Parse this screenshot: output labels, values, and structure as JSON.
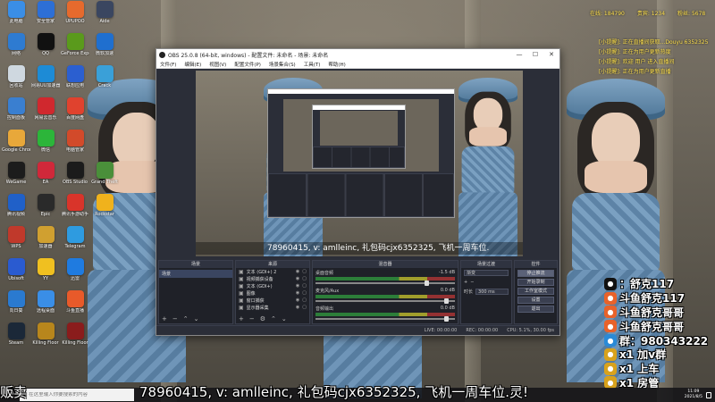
{
  "colors": {
    "overlay_yellow": "#ffe14d",
    "obs_bg": "#2b2e38",
    "taskbar": "#141418"
  },
  "desktop_icons": [
    {
      "label": "此电脑",
      "icon": "computer-icon",
      "color": "#3a8ee6"
    },
    {
      "label": "安全管家",
      "icon": "shield-icon",
      "color": "#2d6fd6"
    },
    {
      "label": "UPUPOO",
      "icon": "app-icon",
      "color": "#e66a2d"
    },
    {
      "label": "Aide",
      "icon": "app-icon",
      "color": "#3a4660"
    },
    {
      "label": "网络",
      "icon": "network-icon",
      "color": "#2e7bd1"
    },
    {
      "label": "QQ",
      "icon": "qq-icon",
      "color": "#111"
    },
    {
      "label": "GeForce Experience",
      "icon": "nvidia-icon",
      "color": "#5a9a1c"
    },
    {
      "label": "微软加速",
      "icon": "app-icon",
      "color": "#1f6fcf"
    },
    {
      "label": "回收站",
      "icon": "recycle-bin-icon",
      "color": "#cfd8e0"
    },
    {
      "label": "网易UU加速器",
      "icon": "app-icon",
      "color": "#1d8bd6"
    },
    {
      "label": "联想应用",
      "icon": "app-icon",
      "color": "#2b5fd0"
    },
    {
      "label": "Crack",
      "icon": "app-icon",
      "color": "#3aa0d8"
    },
    {
      "label": "控制面板",
      "icon": "control-panel-icon",
      "color": "#3a7fd0"
    },
    {
      "label": "网易云音乐",
      "icon": "music-icon",
      "color": "#d0282e"
    },
    {
      "label": "百度网盘",
      "icon": "app-icon",
      "color": "#e0422e"
    },
    {
      "label": "",
      "icon": "blank-icon",
      "color": "transparent"
    },
    {
      "label": "Google Chrome",
      "icon": "chrome-icon",
      "color": "#e8a83a"
    },
    {
      "label": "微信",
      "icon": "wechat-icon",
      "color": "#2cb53a"
    },
    {
      "label": "电脑管家",
      "icon": "app-icon",
      "color": "#d24a2a"
    },
    {
      "label": "",
      "icon": "blank-icon",
      "color": "transparent"
    },
    {
      "label": "WeGame",
      "icon": "app-icon",
      "color": "#1c1c1c"
    },
    {
      "label": "EA",
      "icon": "app-icon",
      "color": "#d0283a"
    },
    {
      "label": "OBS Studio",
      "icon": "obs-icon",
      "color": "#1b1b1b"
    },
    {
      "label": "Grand Theft",
      "icon": "game-icon",
      "color": "#4a8f3a"
    },
    {
      "label": "腾讯视频",
      "icon": "video-icon",
      "color": "#2060c8"
    },
    {
      "label": "Epic",
      "icon": "app-icon",
      "color": "#2a2a2a"
    },
    {
      "label": "腾讯手游助手",
      "icon": "app-icon",
      "color": "#d9342a"
    },
    {
      "label": "Rockstar",
      "icon": "rockstar-icon",
      "color": "#f0b21c"
    },
    {
      "label": "WPS",
      "icon": "wps-icon",
      "color": "#c0392b"
    },
    {
      "label": "加速器",
      "icon": "app-icon",
      "color": "#d0a030"
    },
    {
      "label": "Telegram",
      "icon": "telegram-icon",
      "color": "#2e9be0"
    },
    {
      "label": "",
      "icon": "blank-icon",
      "color": "transparent"
    },
    {
      "label": "Ubisoft",
      "icon": "app-icon",
      "color": "#2a5bd0"
    },
    {
      "label": "YY",
      "icon": "app-icon",
      "color": "#f0c020"
    },
    {
      "label": "迅雷",
      "icon": "thunder-icon",
      "color": "#1f7be0"
    },
    {
      "label": "",
      "icon": "blank-icon",
      "color": "transparent"
    },
    {
      "label": "向日葵",
      "icon": "app-icon",
      "color": "#2a7ad0"
    },
    {
      "label": "远程桌面",
      "icon": "app-icon",
      "color": "#3a8ee6"
    },
    {
      "label": "斗鱼直播",
      "icon": "app-icon",
      "color": "#e85a2a"
    },
    {
      "label": "",
      "icon": "blank-icon",
      "color": "transparent"
    },
    {
      "label": "Steam",
      "icon": "steam-icon",
      "color": "#1b2838"
    },
    {
      "label": "Killing Floor",
      "icon": "game-icon",
      "color": "#b8861c"
    },
    {
      "label": "Killing Floor",
      "icon": "game-icon",
      "color": "#8a1c1c"
    }
  ],
  "obs": {
    "title": "OBS 25.0.8 (64-bit, windows) - 配置文件: 未命名 - 场景: 未命名",
    "menu": [
      "文件(F)",
      "编辑(E)",
      "视图(V)",
      "配置文件(P)",
      "场景集合(S)",
      "工具(T)",
      "帮助(H)"
    ],
    "window_buttons": {
      "minimize": "—",
      "maximize": "☐",
      "close": "✕"
    },
    "preview_marquee": "78960415, v: amlleinc, 礼包码cjx6352325, 飞机一周车位.",
    "docks": {
      "scenes": {
        "header": "场景",
        "items": [
          "场景"
        ]
      },
      "sources": {
        "header": "来源",
        "items": [
          "文本 (GDI+) 2",
          "视频捕获设备",
          "文本 (GDI+)",
          "图像",
          "窗口捕获",
          "显示器采集"
        ]
      },
      "mixer": {
        "header": "混音器",
        "tracks": [
          {
            "name": "桌面音频",
            "db": "-1.5 dB"
          },
          {
            "name": "麦克风/Aux",
            "db": "0.0 dB"
          },
          {
            "name": "音频输出",
            "db": "0.0 dB"
          }
        ]
      },
      "transitions": {
        "header": "场景过渡",
        "type": "渐变",
        "duration_label": "时长",
        "duration": "300 ms"
      },
      "controls": {
        "header": "控件",
        "buttons": [
          "停止推流",
          "开始录制",
          "工作室模式",
          "设置",
          "退出"
        ]
      }
    },
    "status": {
      "live": "LIVE: 00:00:00",
      "rec": "REC: 00:00:00",
      "cpu": "CPU: 5.1%, 30.00 fps"
    }
  },
  "info_overlay": {
    "stats": [
      "在线: 184790",
      "贵宾: 1234",
      "粉丝: 5678"
    ],
    "lines": [
      "[小提醒]: 正在直播间获取...Douyu 6352325",
      "[小提醒]: 正在为用户更新热度",
      "[小提醒]: 欢迎 用户 进入直播间",
      "[小提醒]: 正在为用户更新直播"
    ]
  },
  "promo": [
    {
      "icon": "tiktok-icon",
      "color": "#111",
      "text": "：舒克117"
    },
    {
      "icon": "douyu-icon",
      "color": "#e8622a",
      "text": "斗鱼舒克117"
    },
    {
      "icon": "douyu-icon",
      "color": "#e8622a",
      "text": "斗鱼舒克哥哥"
    },
    {
      "icon": "douyu-icon",
      "color": "#e8622a",
      "text": "斗鱼舒克哥哥"
    },
    {
      "icon": "qq-icon",
      "color": "#2a8ad6",
      "text": "群：980343222"
    },
    {
      "icon": "plane-icon",
      "color": "#d8a21c",
      "text": "x1 加v群"
    },
    {
      "icon": "plane-icon",
      "color": "#d8a21c",
      "text": "x1 上车"
    },
    {
      "icon": "plane-icon",
      "color": "#d8a21c",
      "text": "x1 房管"
    }
  ],
  "marquee": {
    "left": "贩卖",
    "main": "78960415, v: amlleinc, 礼包码cjx6352325, 飞机一周车位.灵!"
  },
  "taskbar": {
    "search_placeholder": "在这里输入你要搜索的内容",
    "time": "11:09",
    "date": "2021/8/5"
  }
}
